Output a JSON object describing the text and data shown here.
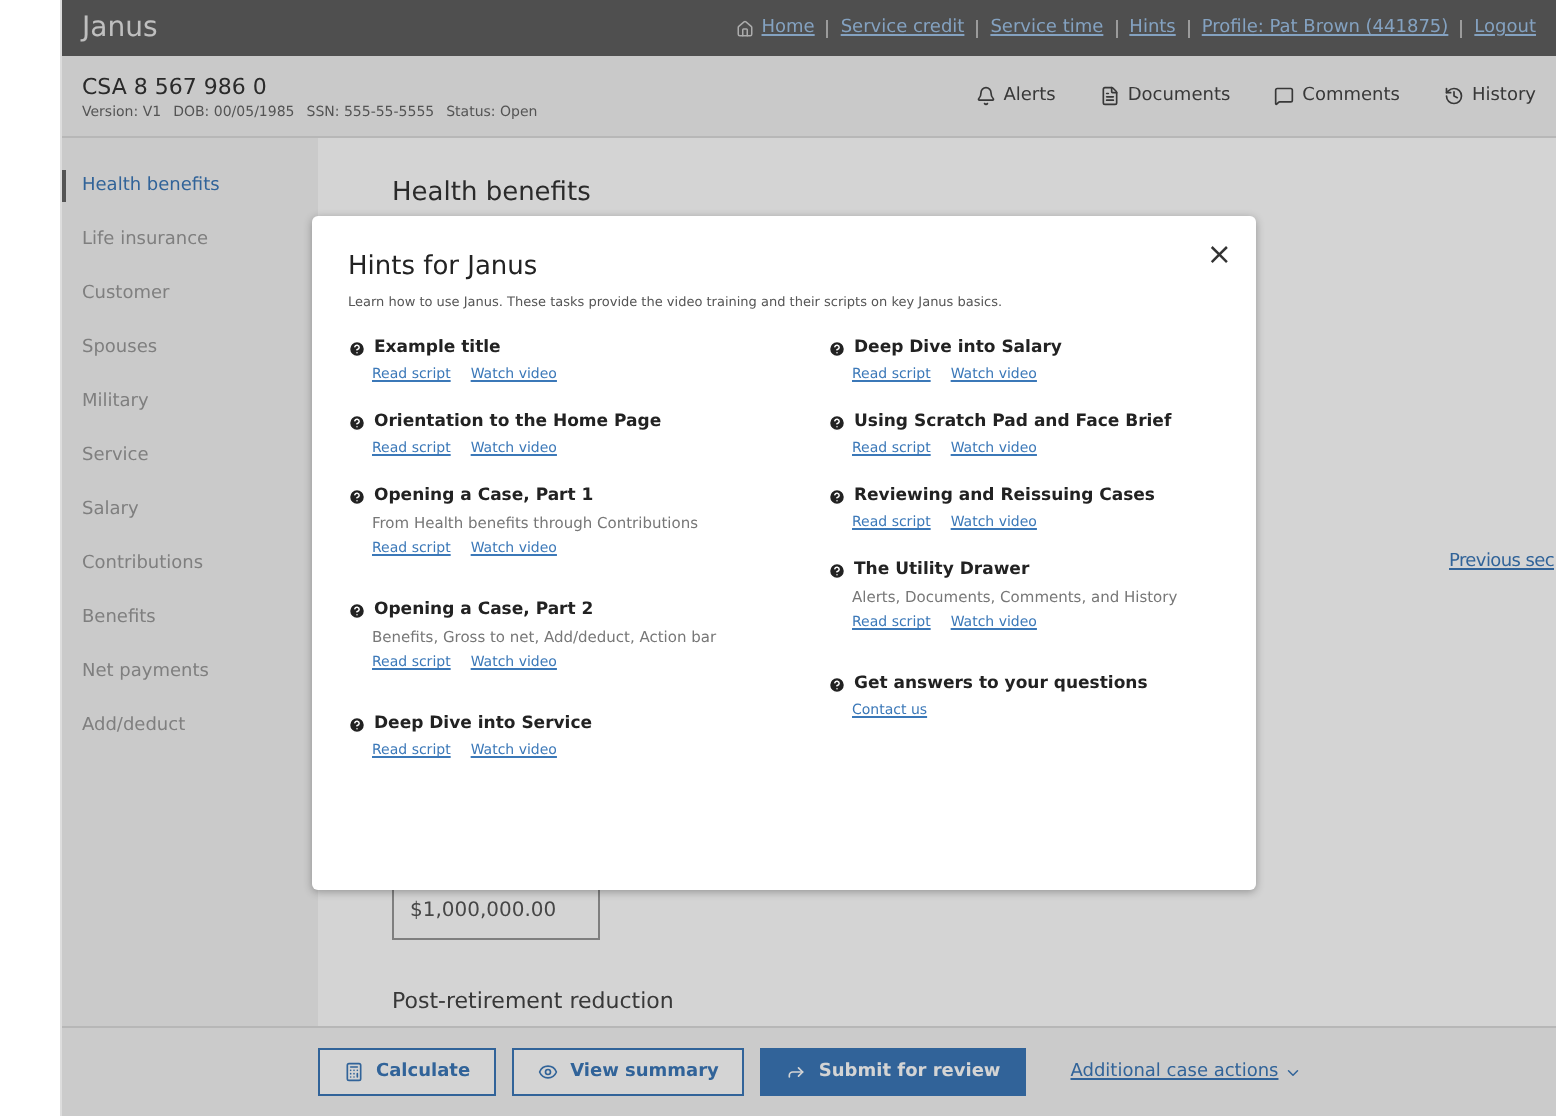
{
  "app": {
    "title": "Janus"
  },
  "top_nav": [
    {
      "label": "Home",
      "kind": "home"
    },
    {
      "label": "Service credit"
    },
    {
      "label": "Service time"
    },
    {
      "label": "Hints"
    },
    {
      "label": "Profile: Pat Brown (441875)"
    },
    {
      "label": "Logout"
    }
  ],
  "case": {
    "number": "CSA 8 567 986 0",
    "meta": [
      {
        "label": "Version:",
        "value": "V1"
      },
      {
        "label": "DOB:",
        "value": "00/05/1985"
      },
      {
        "label": "SSN:",
        "value": "555-55-5555"
      },
      {
        "label": "Status:",
        "value": "Open"
      }
    ]
  },
  "utility": [
    {
      "label": "Alerts",
      "kind": "bell"
    },
    {
      "label": "Documents",
      "kind": "file"
    },
    {
      "label": "Comments",
      "kind": "chat"
    },
    {
      "label": "History",
      "kind": "history"
    }
  ],
  "sidebar": {
    "items": [
      {
        "label": "Health benefits",
        "selected": true
      },
      {
        "label": "Life insurance",
        "selected": false
      },
      {
        "label": "Customer",
        "selected": false
      },
      {
        "label": "Spouses",
        "selected": false
      },
      {
        "label": "Military",
        "selected": false
      },
      {
        "label": "Service",
        "selected": false
      },
      {
        "label": "Salary",
        "selected": false
      },
      {
        "label": "Contributions",
        "selected": false
      },
      {
        "label": "Benefits",
        "selected": false
      },
      {
        "label": "Net payments",
        "selected": false
      },
      {
        "label": "Add/deduct",
        "selected": false
      }
    ]
  },
  "main": {
    "heading": "Health benefits",
    "amount": "$1,000,000.00",
    "section_label": "Post-retirement reduction",
    "previous_link": "Previous sec"
  },
  "modal": {
    "title": "Hints for Janus",
    "close": "×",
    "intro": "Learn how to use Janus. These tasks provide the video training and their scripts on key Janus basics.",
    "columns": [
      [
        {
          "title": "Example title",
          "links": [
            "Read script",
            "Watch video"
          ]
        },
        {
          "title": "Orientation to the Home Page",
          "links": [
            "Read script",
            "Watch video"
          ]
        },
        {
          "title": "Opening a Case, Part 1",
          "description": "From Health benefits through Contributions",
          "links": [
            "Read script",
            "Watch video"
          ]
        },
        {
          "title": "Opening a Case, Part 2",
          "description": "Benefits, Gross to net, Add/deduct, Action bar",
          "links": [
            "Read script",
            "Watch video"
          ]
        },
        {
          "title": "Deep Dive into Service",
          "links": [
            "Read script",
            "Watch video"
          ]
        }
      ],
      [
        {
          "title": "Deep Dive into Salary",
          "links": [
            "Read script",
            "Watch video"
          ]
        },
        {
          "title": "Using Scratch Pad and Face Brief",
          "links": [
            "Read script",
            "Watch video"
          ]
        },
        {
          "title": "Reviewing and Reissuing Cases",
          "links": [
            "Read script",
            "Watch video"
          ]
        },
        {
          "title": "The Utility Drawer",
          "description": "Alerts, Documents, Comments, and History",
          "links": [
            "Read script",
            "Watch video"
          ]
        },
        {
          "title": "Get answers to your questions",
          "links": [
            "Contact us"
          ]
        }
      ]
    ]
  },
  "actions": [
    {
      "label": "Calculate",
      "kind": "calculator",
      "primary": false
    },
    {
      "label": "View summary",
      "kind": "eye",
      "primary": false
    },
    {
      "label": "Submit for review",
      "kind": "send",
      "primary": true
    }
  ],
  "more_actions": "Additional case actions"
}
